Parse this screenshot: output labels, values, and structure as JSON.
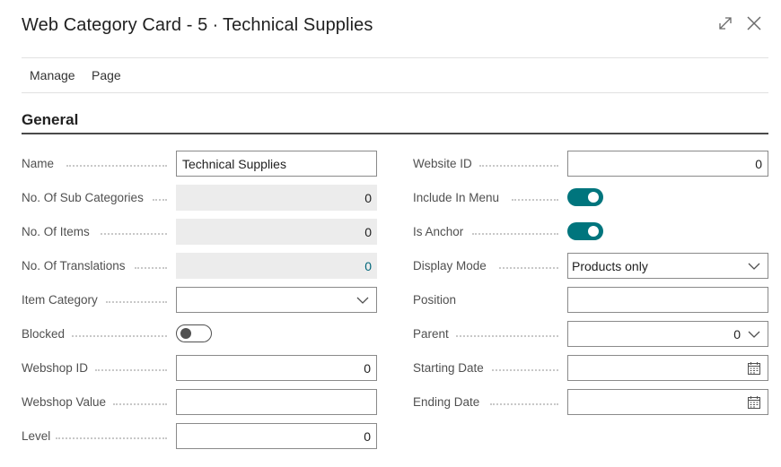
{
  "window": {
    "title": "Web Category Card - 5 ∙ Technical Supplies"
  },
  "menu": {
    "items": [
      "Manage",
      "Page"
    ]
  },
  "section": {
    "title": "General"
  },
  "left": {
    "name": {
      "label": "Name",
      "value": "Technical Supplies"
    },
    "sub_categories": {
      "label": "No. Of Sub Categories",
      "value": "0"
    },
    "items": {
      "label": "No. Of Items",
      "value": "0"
    },
    "translations": {
      "label": "No. Of Translations",
      "value": "0"
    },
    "item_category": {
      "label": "Item Category",
      "value": ""
    },
    "blocked": {
      "label": "Blocked",
      "value": false
    },
    "webshop_id": {
      "label": "Webshop ID",
      "value": "0"
    },
    "webshop_value": {
      "label": "Webshop Value",
      "value": ""
    },
    "level": {
      "label": "Level",
      "value": "0"
    }
  },
  "right": {
    "website_id": {
      "label": "Website ID",
      "value": "0"
    },
    "include_in_menu": {
      "label": "Include In Menu",
      "value": true
    },
    "is_anchor": {
      "label": "Is Anchor",
      "value": true
    },
    "display_mode": {
      "label": "Display Mode",
      "value": "Products only"
    },
    "position": {
      "label": "Position",
      "value": ""
    },
    "parent": {
      "label": "Parent",
      "value": "0"
    },
    "starting_date": {
      "label": "Starting Date",
      "value": ""
    },
    "ending_date": {
      "label": "Ending Date",
      "value": ""
    }
  },
  "colors": {
    "accent": "#00757d",
    "link": "#00667a",
    "readonly_bg": "#ececec"
  },
  "icons": {
    "expand": "expand-icon",
    "close": "close-icon",
    "dropdown": "chevron-down-icon",
    "calendar": "calendar-icon"
  }
}
